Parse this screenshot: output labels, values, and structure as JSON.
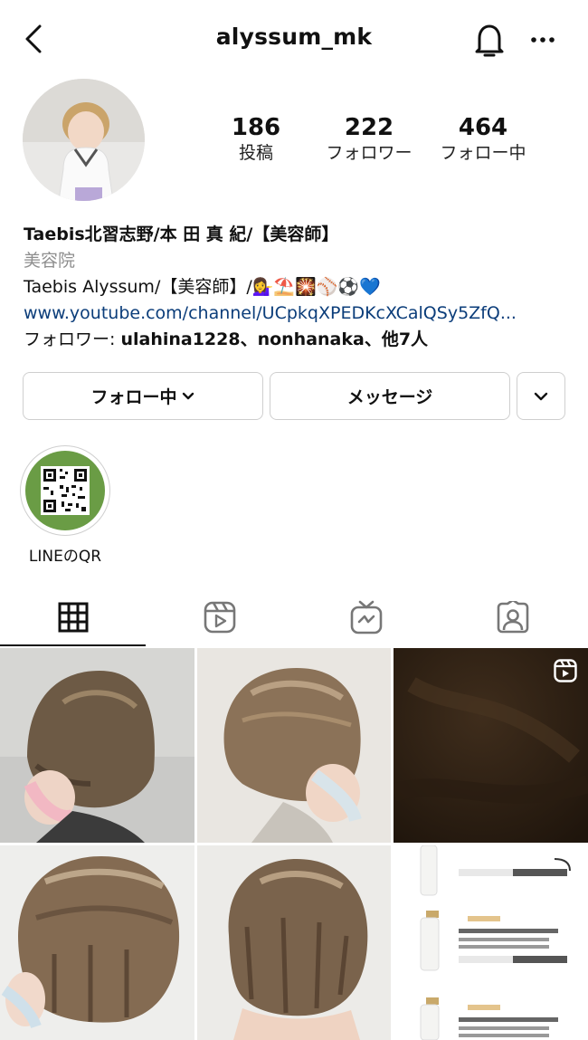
{
  "header": {
    "username": "alyssum_mk"
  },
  "stats": [
    {
      "value": "186",
      "label": "投稿"
    },
    {
      "value": "222",
      "label": "フォロワー"
    },
    {
      "value": "464",
      "label": "フォロー中"
    }
  ],
  "bio": {
    "name": "Taebis北習志野/本 田 真 紀/【美容師】",
    "category": "美容院",
    "text": "Taebis Alyssum/【美容師】/💁‍♀️⛱️🎇⚾⚽💙",
    "link": "www.youtube.com/channel/UCpkqXPEDKcXCalQSy5ZfQ...",
    "followed_prefix": "フォロワー: ",
    "followed_names": "ulahina1228、nonhanaka、他7人"
  },
  "buttons": {
    "following": "フォロー中",
    "message": "メッセージ"
  },
  "highlights": [
    {
      "label": "LINEのQR"
    }
  ],
  "colors": {
    "link": "#0b3d7a",
    "muted": "#8e8e8e",
    "border": "#cfcfcf",
    "highlight_bg": "#6a9c45"
  }
}
